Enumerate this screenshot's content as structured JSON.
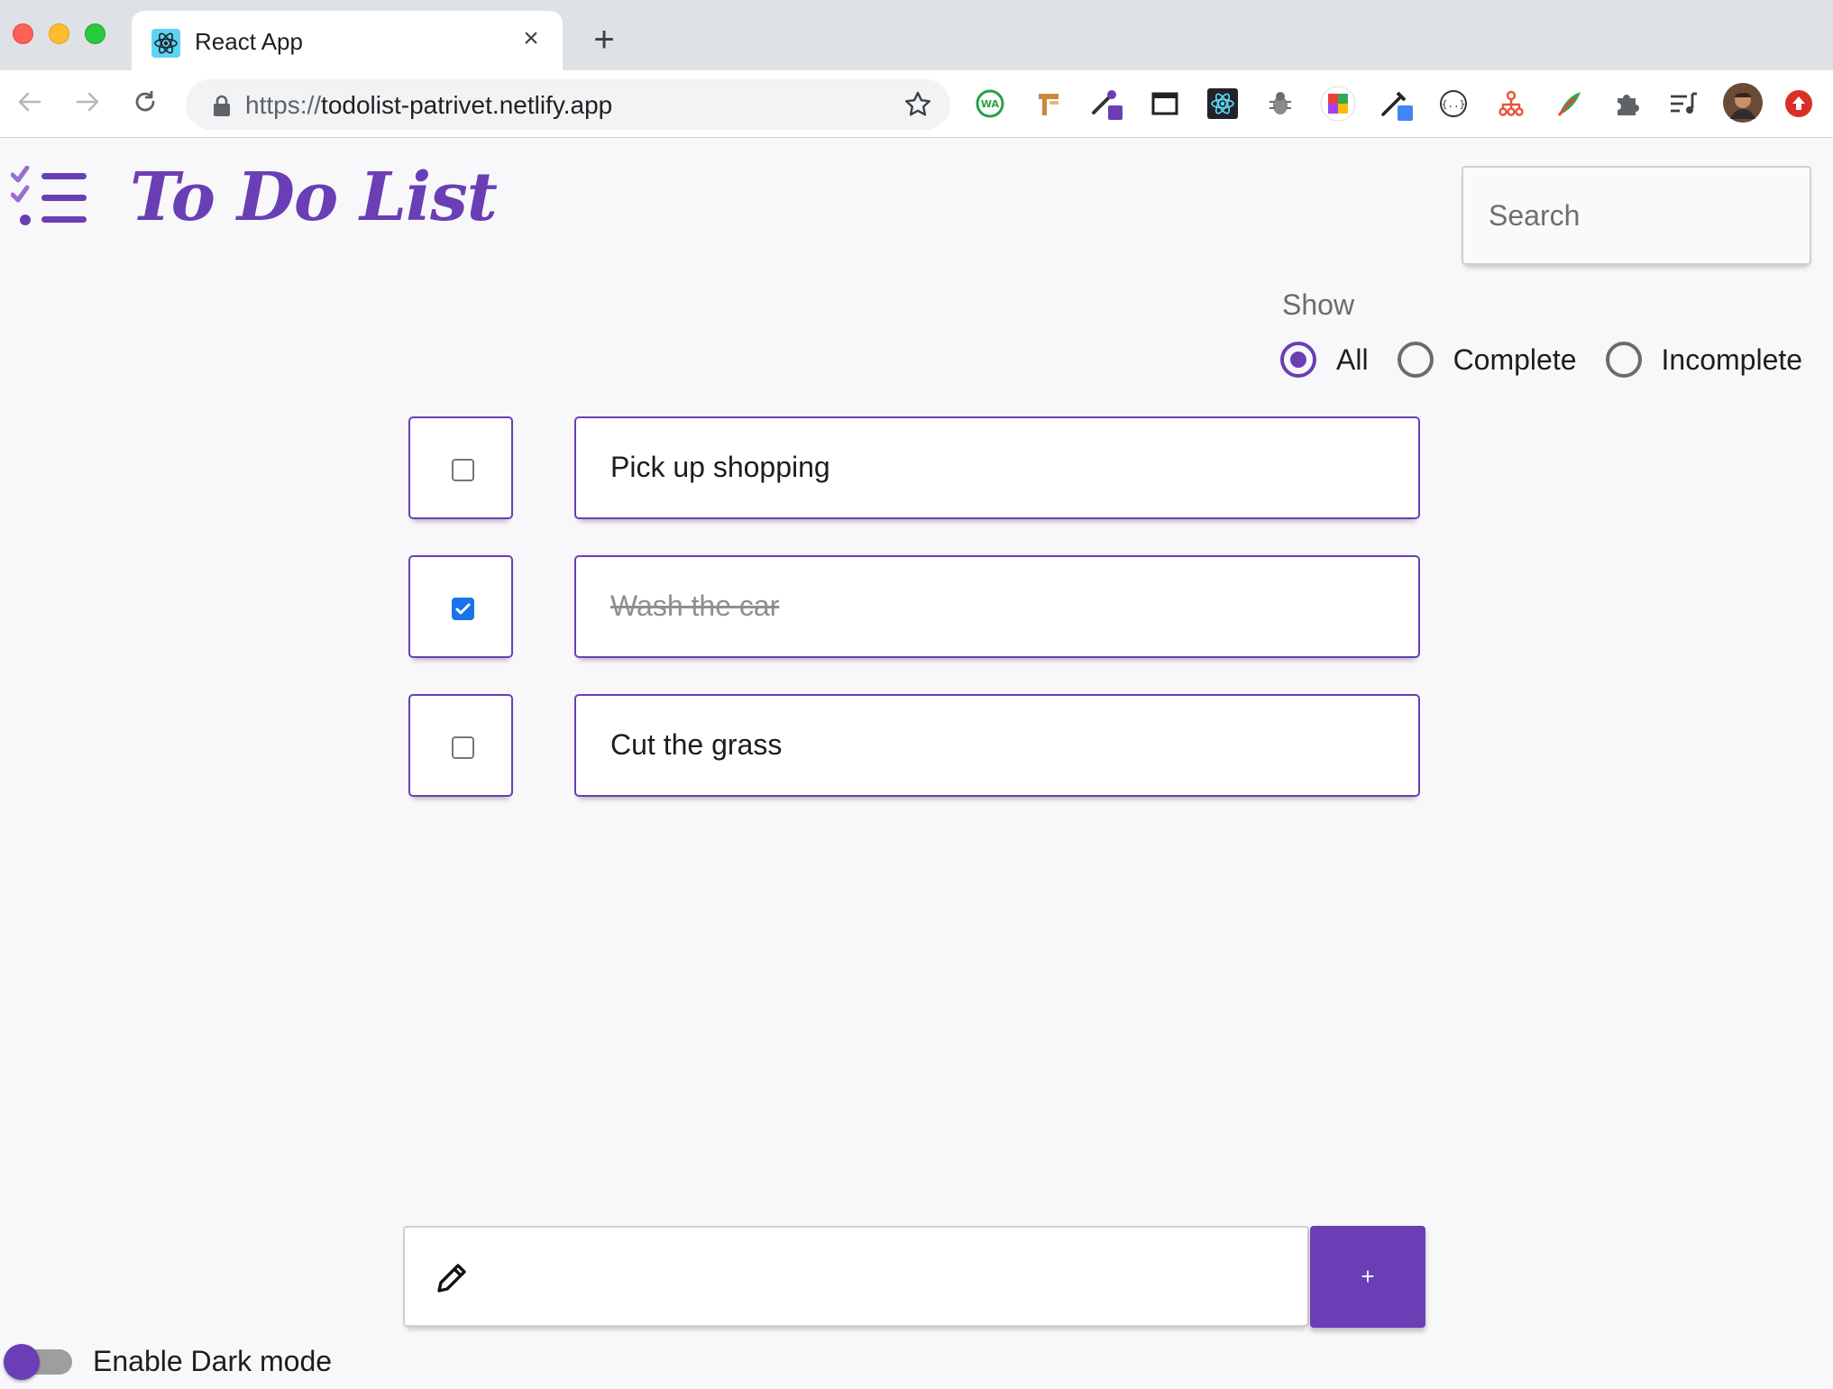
{
  "browser": {
    "tab_title": "React App",
    "tab_close": "×",
    "new_tab": "+",
    "url_scheme": "https://",
    "url_host": "todolist-patrivet.netlify.app",
    "extensions": [
      "whatsapp-extension-icon",
      "wappalyzer-icon",
      "color-picker-icon",
      "window-resizer-icon",
      "react-devtools-icon",
      "bug-icon",
      "colorzilla-icon",
      "eyedropper-icon",
      "json-viewer-icon",
      "sitemap-icon",
      "feather-icon",
      "extensions-puzzle-icon",
      "reading-list-icon",
      "profile-avatar",
      "update-icon"
    ]
  },
  "app": {
    "title": "To Do List",
    "search_placeholder": "Search",
    "filter": {
      "legend": "Show",
      "options": [
        {
          "label": "All",
          "checked": true
        },
        {
          "label": "Complete",
          "checked": false
        },
        {
          "label": "Incomplete",
          "checked": false
        }
      ]
    },
    "todos": [
      {
        "text": "Pick up shopping",
        "done": false
      },
      {
        "text": "Wash the car",
        "done": true
      },
      {
        "text": "Cut the grass",
        "done": false
      }
    ],
    "add_button_label": "+",
    "new_todo_value": "",
    "dark_mode_label": "Enable Dark mode",
    "dark_mode_enabled": false
  },
  "colors": {
    "accent": "#6a3fb5",
    "checkbox_checked": "#1a73e8",
    "background": "#f8f8fa"
  }
}
